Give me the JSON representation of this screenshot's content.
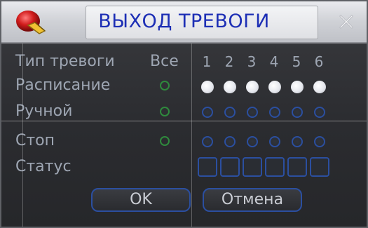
{
  "dialog": {
    "title": "ВЫХОД ТРЕВОГИ",
    "logo_icon": "alarm-logo-icon",
    "close_icon": "close-icon"
  },
  "header": {
    "type_label": "Тип тревоги",
    "all_label": "Все",
    "channels": [
      "1",
      "2",
      "3",
      "4",
      "5",
      "6"
    ]
  },
  "rows": {
    "schedule": {
      "label": "Расписание",
      "all_selected": false,
      "channels": [
        true,
        true,
        true,
        true,
        true,
        true
      ]
    },
    "manual": {
      "label": "Ручной",
      "all_selected": false,
      "channels": [
        false,
        false,
        false,
        false,
        false,
        false
      ]
    },
    "stop": {
      "label": "Стоп",
      "all_selected": false,
      "channels": [
        false,
        false,
        false,
        false,
        false,
        false
      ]
    },
    "status": {
      "label": "Статус",
      "channels": [
        false,
        false,
        false,
        false,
        false,
        false
      ]
    }
  },
  "buttons": {
    "ok": "OK",
    "cancel": "Отмена"
  },
  "colors": {
    "title": "#1d2fb5",
    "text": "#9ea6b3",
    "ring_green": "#2f8a3d",
    "ring_blue": "#2b4fa0"
  }
}
